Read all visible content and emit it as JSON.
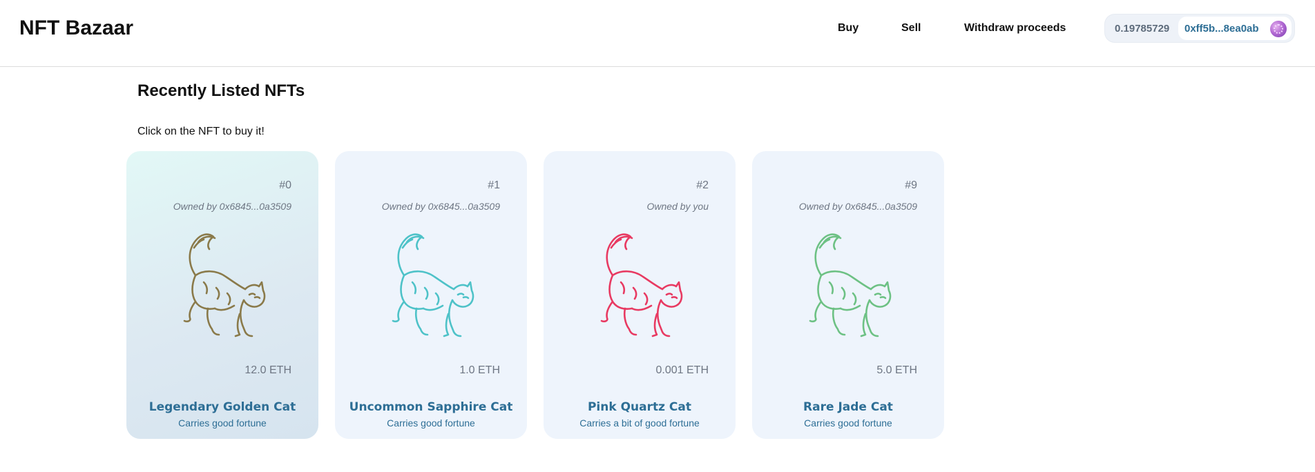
{
  "header": {
    "brand": "NFT Bazaar",
    "nav": {
      "buy": "Buy",
      "sell": "Sell",
      "withdraw": "Withdraw proceeds"
    },
    "wallet": {
      "balance": "0.19785729",
      "address": "0xff5b...8ea0ab",
      "avatar_icon": "identicon-avatar"
    }
  },
  "main": {
    "title": "Recently Listed NFTs",
    "hint": "Click on the NFT to buy it!",
    "cards": [
      {
        "id": "#0",
        "owner": "Owned by 0x6845...0a3509",
        "price": "12.0 ETH",
        "name": "Legendary Golden Cat",
        "description": "Carries good fortune",
        "color": "#8a7a4a",
        "icon": "cat-icon"
      },
      {
        "id": "#1",
        "owner": "Owned by 0x6845...0a3509",
        "price": "1.0 ETH",
        "name": "Uncommon Sapphire Cat",
        "description": "Carries good fortune",
        "color": "#4ec2c8",
        "icon": "cat-icon"
      },
      {
        "id": "#2",
        "owner": "Owned by you",
        "price": "0.001 ETH",
        "name": "Pink Quartz Cat",
        "description": "Carries a bit of good fortune",
        "color": "#e83a62",
        "icon": "cat-icon"
      },
      {
        "id": "#9",
        "owner": "Owned by 0x6845...0a3509",
        "price": "5.0 ETH",
        "name": "Rare Jade Cat",
        "description": "Carries good fortune",
        "color": "#6dc184",
        "icon": "cat-icon"
      }
    ]
  }
}
